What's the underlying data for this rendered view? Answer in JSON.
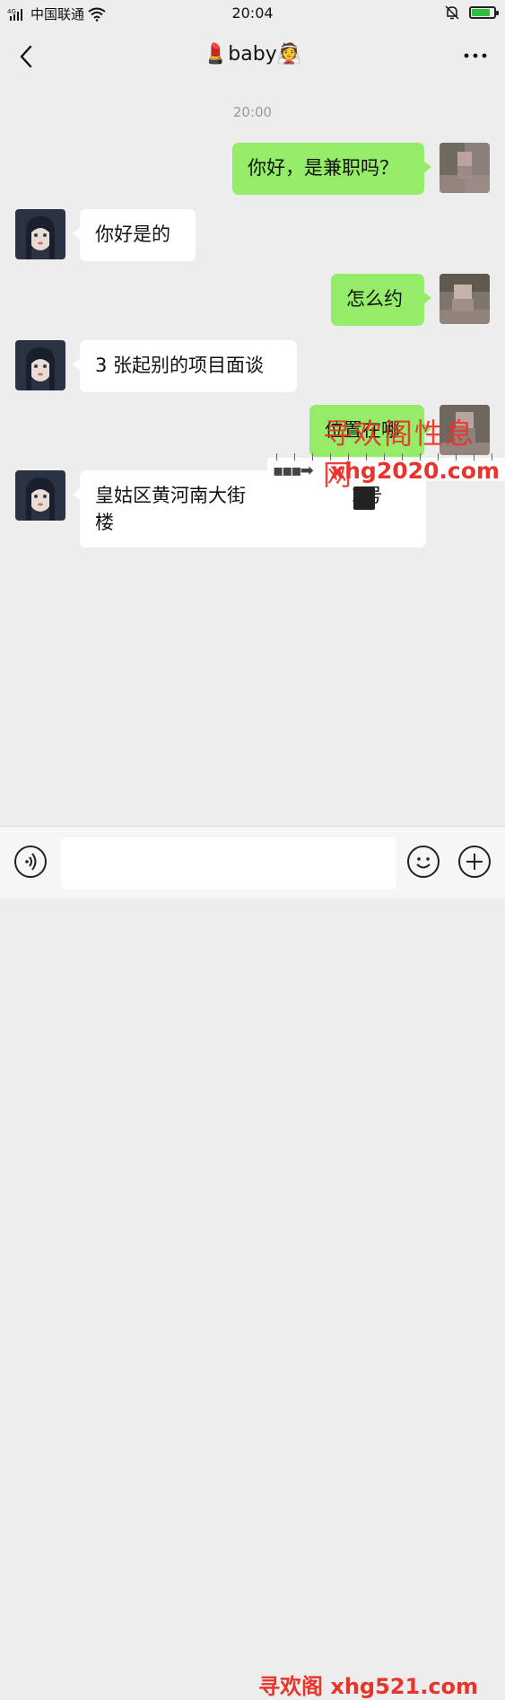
{
  "status_bar": {
    "signal_tag": "4G",
    "carrier": "中国联通",
    "time": "20:04",
    "battery_level": 0.75,
    "icons": [
      "signal-icon",
      "wifi-icon",
      "bell-muted-icon",
      "battery-charging-icon"
    ]
  },
  "nav": {
    "title": "💄baby👰",
    "back_icon": "chevron-left-icon",
    "more_icon": "more-dots-icon"
  },
  "timestamp": "20:00",
  "messages": [
    {
      "direction": "out",
      "text": "你好，是兼职吗？",
      "avatar": "avatar-self"
    },
    {
      "direction": "in",
      "text": "你好是的",
      "avatar": "avatar-contact"
    },
    {
      "direction": "out",
      "text": "怎么约",
      "avatar": "avatar-self"
    },
    {
      "direction": "in",
      "text": "3 张起别的项目面谈",
      "avatar": "avatar-contact"
    },
    {
      "direction": "out",
      "text": "位置在哪",
      "avatar": "avatar-self"
    },
    {
      "direction": "in",
      "text": "皇姑区黄河南大街💭 2号楼",
      "avatar": "avatar-contact",
      "line1": "皇姑区黄河南大街",
      "line1_tail": "2号",
      "line2": "楼"
    }
  ],
  "watermark": {
    "top_text": "寻欢阁性息网",
    "top_url": "xhg2020.com",
    "bottom_text": "寻欢阁 xhg521.com"
  },
  "input_bar": {
    "voice_icon": "voice-icon",
    "emoji_icon": "emoji-icon",
    "plus_icon": "plus-icon",
    "value": ""
  },
  "colors": {
    "background": "#ededed",
    "bubble_out": "#95ec69",
    "bubble_in": "#ffffff",
    "watermark": "#e8342b"
  }
}
